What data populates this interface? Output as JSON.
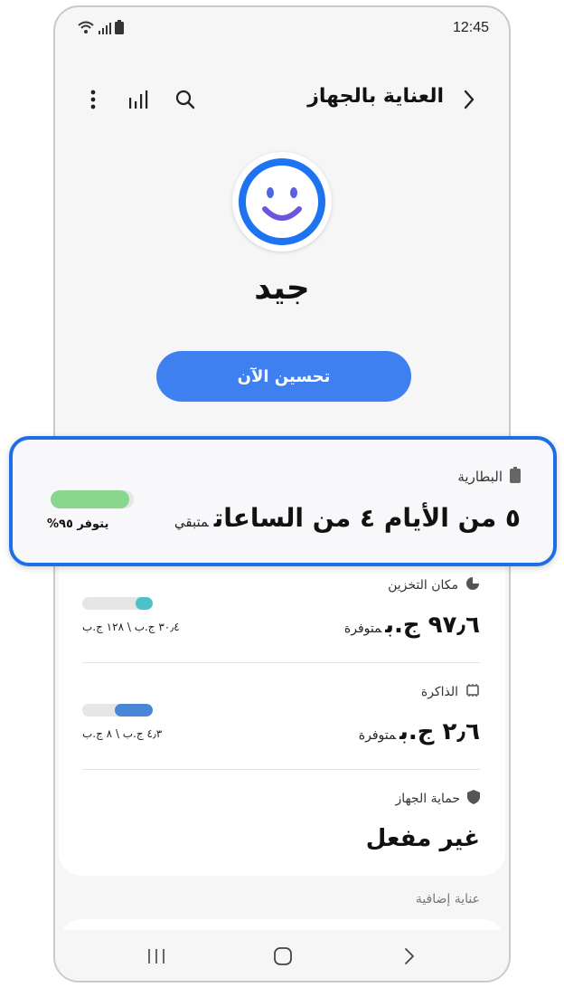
{
  "status_bar": {
    "time": "12:45",
    "icons": [
      "wifi-icon",
      "signal-icon",
      "battery-icon"
    ]
  },
  "app_bar": {
    "title": "العناية بالجهاز",
    "icons": [
      "back-icon",
      "search-icon",
      "stats-icon",
      "more-icon"
    ]
  },
  "overall": {
    "status": "جيد",
    "face_icon": "smiley-icon",
    "accent": "#1e6fe6"
  },
  "optimize_button": {
    "label": "تحسين الآن",
    "color": "#3e80f0"
  },
  "battery": {
    "title": "البطارية",
    "value": "٥ من الأيام ٤ من الساعات",
    "suffix": "متبقي",
    "available": "يتوفر ٩٥%",
    "level_fraction": 0.95,
    "bar_color": "#87d88c"
  },
  "storage": {
    "title": "مكان التخزين",
    "value": "٩٧٫٦ ج.ب",
    "suffix": "متوفرة",
    "usage": "٣٠٫٤ ج.ب \\ ١٢٨ ج.ب",
    "used_fraction": 0.24,
    "bar_color": "#4fc1c6"
  },
  "memory": {
    "title": "الذاكرة",
    "value": "٢٫٦ ج.ب",
    "suffix": "متوفرة",
    "usage": "٤٫٣ ج.ب \\ ٨ ج.ب",
    "used_fraction": 0.54,
    "bar_color": "#4a86d8"
  },
  "protection": {
    "title": "حماية الجهاز",
    "value": "غير مفعل"
  },
  "extra_care": {
    "label": "عناية إضافية"
  },
  "nav_bar": {
    "icons": [
      "recents-icon",
      "home-icon",
      "back-nav-icon"
    ]
  }
}
